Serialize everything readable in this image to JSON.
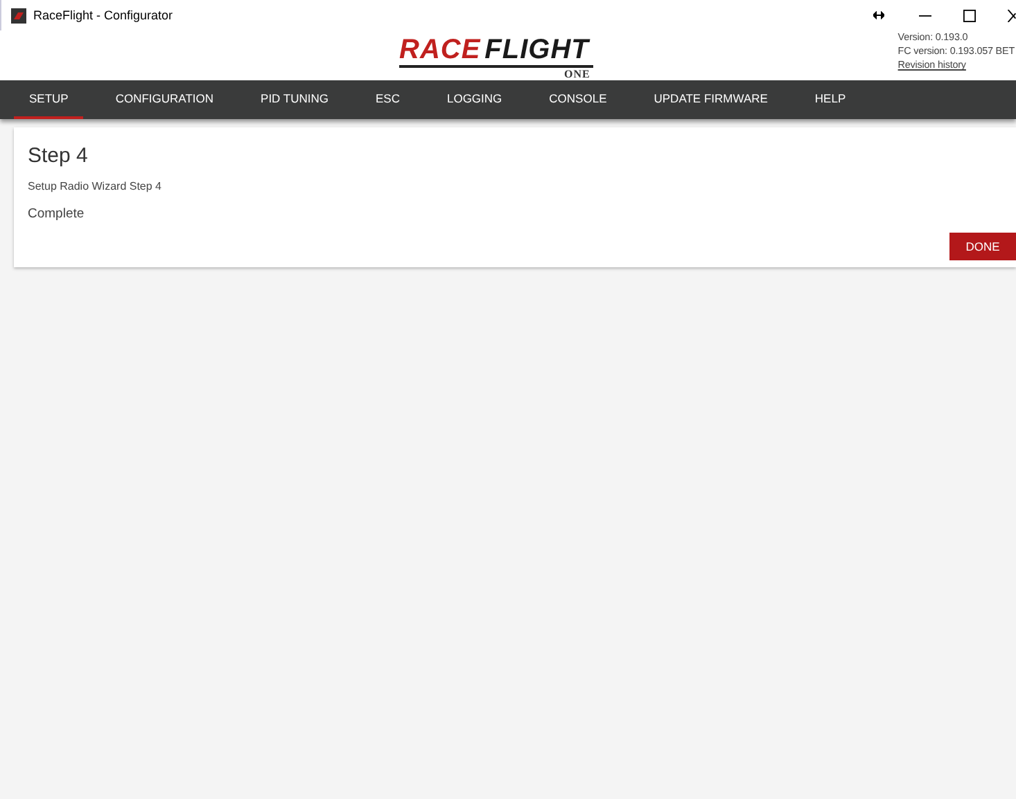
{
  "window": {
    "title": "RaceFlight - Configurator"
  },
  "logo": {
    "main_red": "RACE",
    "main_dark": "FLIGHT",
    "sub": "ONE"
  },
  "version": {
    "app": "Version: 0.193.0",
    "fc": "FC version: 0.193.057 BET",
    "link": "Revision history"
  },
  "tabs": [
    {
      "label": "SETUP",
      "selected": true
    },
    {
      "label": "CONFIGURATION",
      "selected": false
    },
    {
      "label": "PID TUNING",
      "selected": false
    },
    {
      "label": "ESC",
      "selected": false
    },
    {
      "label": "LOGGING",
      "selected": false
    },
    {
      "label": "CONSOLE",
      "selected": false
    },
    {
      "label": "UPDATE FIRMWARE",
      "selected": false
    },
    {
      "label": "HELP",
      "selected": false
    }
  ],
  "card": {
    "title": "Step 4",
    "subtitle": "Setup Radio Wizard Step 4",
    "status": "Complete",
    "button": "DONE"
  }
}
